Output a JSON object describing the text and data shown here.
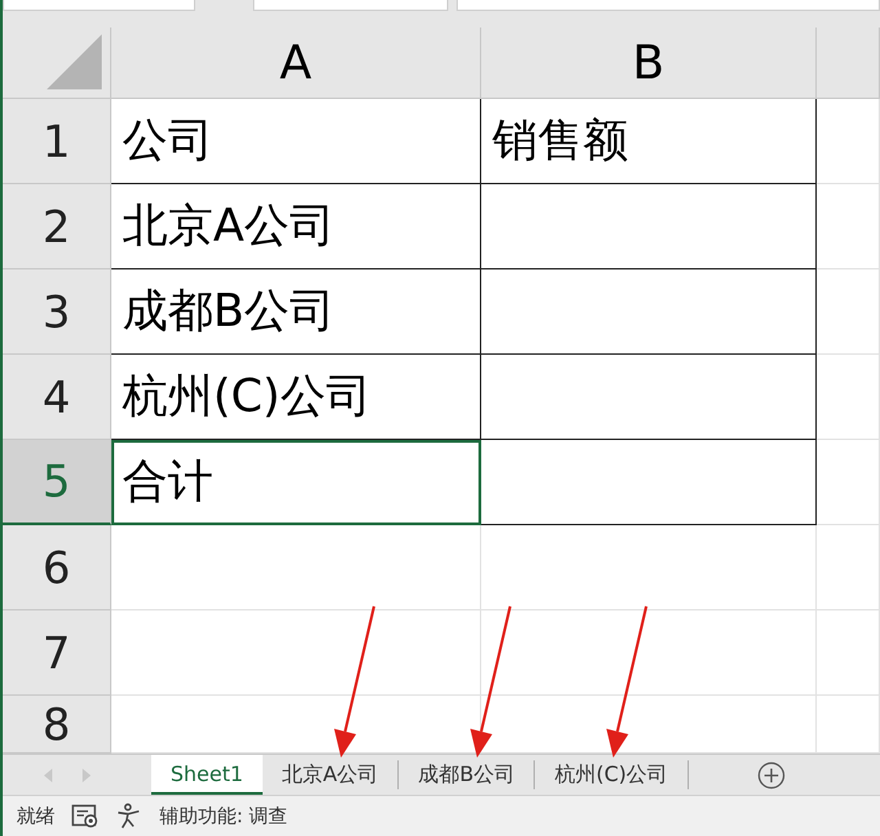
{
  "columns": [
    "A",
    "B"
  ],
  "rows": [
    {
      "number": "1",
      "a": "公司",
      "b": "销售额",
      "selected": false,
      "bordered": true
    },
    {
      "number": "2",
      "a": "北京A公司",
      "selected": false,
      "bordered": true
    },
    {
      "number": "3",
      "a": "成都B公司",
      "selected": false,
      "bordered": true
    },
    {
      "number": "4",
      "a": "杭州(C)公司",
      "selected": false,
      "bordered": true
    },
    {
      "number": "5",
      "a": "合计",
      "selected": true,
      "bordered": true
    },
    {
      "number": "6",
      "selected": false,
      "bordered": false
    },
    {
      "number": "7",
      "selected": false,
      "bordered": false
    },
    {
      "number": "8",
      "selected": false,
      "bordered": false
    }
  ],
  "tabs": [
    {
      "label": "Sheet1",
      "selected": true,
      "arrow": false
    },
    {
      "label": "北京A公司",
      "selected": false,
      "arrow": true
    },
    {
      "label": "成都B公司",
      "selected": false,
      "arrow": true
    },
    {
      "label": "杭州(C)公司",
      "selected": false,
      "arrow": true
    }
  ],
  "status_bar": {
    "ready": "就绪",
    "accessibility": "辅助功能: 调查"
  }
}
